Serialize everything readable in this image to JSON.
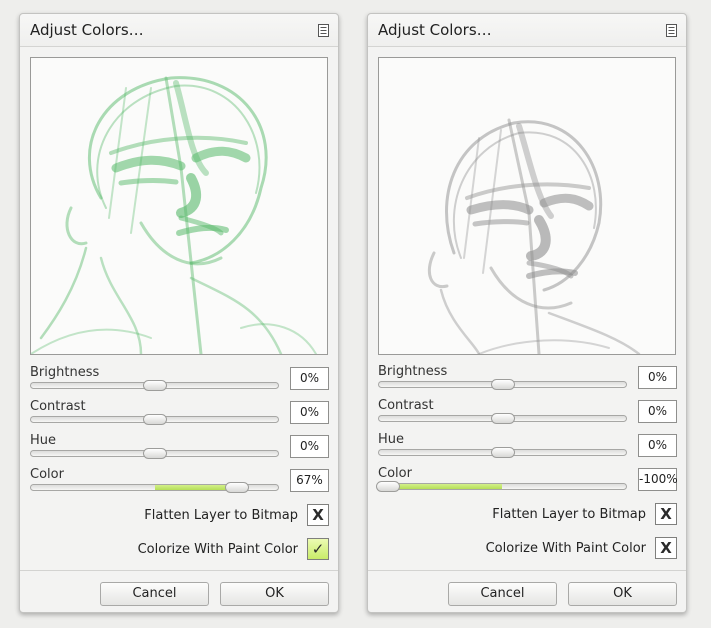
{
  "panels": [
    {
      "title": "Adjust Colors…",
      "sketch_color": "#58b96a",
      "sliders": [
        {
          "label": "Brightness",
          "value": "0%",
          "level": 0
        },
        {
          "label": "Contrast",
          "value": "0%",
          "level": 0
        },
        {
          "label": "Hue",
          "value": "0%",
          "level": 0
        },
        {
          "label": "Color",
          "value": "67%",
          "level": 0.67
        }
      ],
      "options": [
        {
          "label": "Flatten Layer to Bitmap",
          "mark": "X",
          "checked": false
        },
        {
          "label": "Colorize With Paint Color",
          "mark": "✓",
          "checked": true
        }
      ],
      "cancel_label": "Cancel",
      "ok_label": "OK"
    },
    {
      "title": "Adjust Colors…",
      "sketch_color": "#8d8d8d",
      "sliders": [
        {
          "label": "Brightness",
          "value": "0%",
          "level": 0
        },
        {
          "label": "Contrast",
          "value": "0%",
          "level": 0
        },
        {
          "label": "Hue",
          "value": "0%",
          "level": 0
        },
        {
          "label": "Color",
          "value": "-100%",
          "level": -1
        }
      ],
      "options": [
        {
          "label": "Flatten Layer to Bitmap",
          "mark": "X",
          "checked": false
        },
        {
          "label": "Colorize With Paint Color",
          "mark": "X",
          "checked": false
        }
      ],
      "cancel_label": "Cancel",
      "ok_label": "OK"
    }
  ],
  "colors": {
    "accent_fill": "#c1e56b",
    "panel_bg": "#f3f3f2"
  },
  "icons": {
    "menu": "menu-icon"
  }
}
